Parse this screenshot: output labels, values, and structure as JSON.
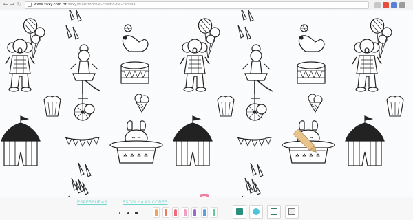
{
  "browser": {
    "url_host": "www.zaxy.com.br",
    "url_path": "/zaxy/maromotive-coelho-de-cartola",
    "back_icon": "back-arrow-icon",
    "forward_icon": "forward-arrow-icon",
    "reload_icon": "reload-icon"
  },
  "toolbar": {
    "thickness_label": "ESPESSURAS",
    "colors_label": "ESCOLHA AS CORES",
    "crayon_colors": [
      "#f0a35a",
      "#f07c5a",
      "#f06a7a",
      "#f2a0c0",
      "#9a6ad0",
      "#5aa0e0",
      "#5fcf9a"
    ],
    "actions": [
      "paint-bucket-icon",
      "mascot-icon",
      "checkbox-icon",
      "print-icon"
    ]
  },
  "colors": {
    "accent": "#6fd6cf",
    "pink": "#f27fa0"
  }
}
